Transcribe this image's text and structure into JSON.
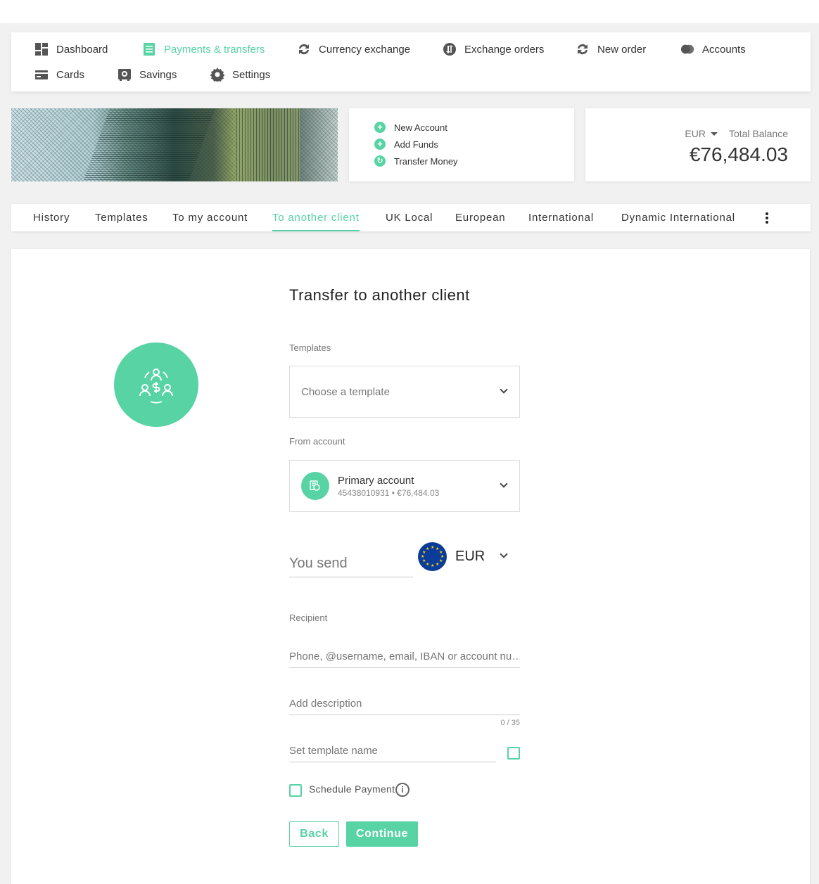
{
  "nav": {
    "items": [
      {
        "label": "Dashboard",
        "icon": "dashboard-icon"
      },
      {
        "label": "Payments & transfers",
        "icon": "payments-icon",
        "active": true
      },
      {
        "label": "Currency exchange",
        "icon": "exchange-icon"
      },
      {
        "label": "Exchange orders",
        "icon": "exchange-orders-icon"
      },
      {
        "label": "New order",
        "icon": "new-order-icon"
      },
      {
        "label": "Accounts",
        "icon": "accounts-icon"
      },
      {
        "label": "Cards",
        "icon": "card-icon"
      },
      {
        "label": "Savings",
        "icon": "savings-icon"
      },
      {
        "label": "Settings",
        "icon": "gear-icon"
      }
    ]
  },
  "quick_actions": [
    {
      "label": "New Account",
      "icon": "plus-circle-icon"
    },
    {
      "label": "Add Funds",
      "icon": "plus-circle-icon"
    },
    {
      "label": "Transfer Money",
      "icon": "transfer-icon"
    }
  ],
  "balance": {
    "currency": "EUR",
    "label": "Total Balance",
    "amount": "€76,484.03"
  },
  "tabs": [
    {
      "label": "History"
    },
    {
      "label": "Templates"
    },
    {
      "label": "To my account"
    },
    {
      "label": "To another client",
      "active": true
    },
    {
      "label": "UK Local"
    },
    {
      "label": "European"
    },
    {
      "label": "International"
    },
    {
      "label": "Dynamic International"
    }
  ],
  "form": {
    "title": "Transfer to another client",
    "templates_label": "Templates",
    "templates_placeholder": "Choose a template",
    "from_account_label": "From account",
    "account_name": "Primary account",
    "account_details": "45438010931 • €76,484.03",
    "send_placeholder": "You send",
    "send_currency": "EUR",
    "recipient_label": "Recipient",
    "recipient_placeholder": "Phone, @username, email, IBAN or account nu…",
    "description_placeholder": "Add description",
    "description_counter": "0 / 35",
    "template_name_placeholder": "Set template name",
    "schedule_label": "Schedule Payment",
    "back_label": "Back",
    "continue_label": "Continue"
  },
  "colors": {
    "accent": "#57d3a4",
    "text": "#333333",
    "background": "#f1f1f1"
  }
}
